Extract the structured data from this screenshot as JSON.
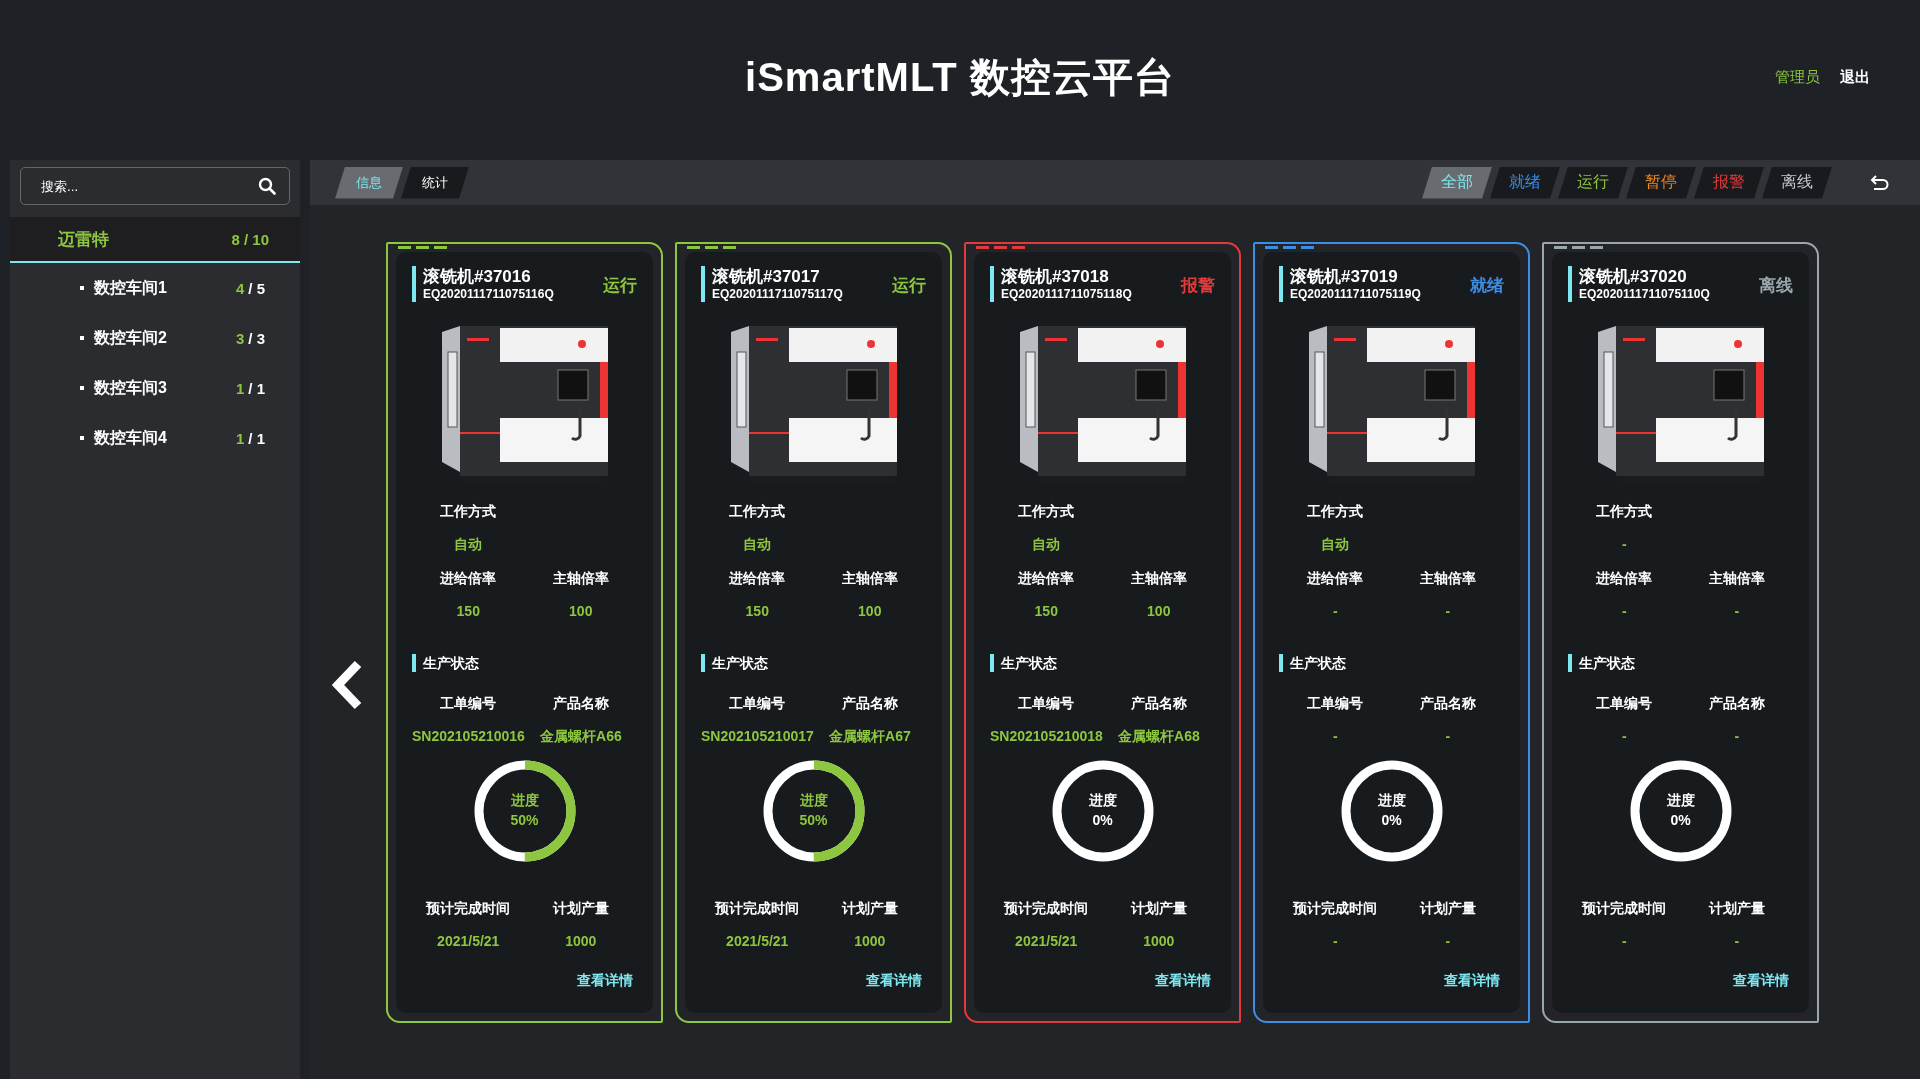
{
  "header": {
    "title": "iSmartMLT 数控云平台",
    "user": "管理员",
    "logout": "退出"
  },
  "sidebar": {
    "search": {
      "placeholder": "搜索..."
    },
    "tree": [
      {
        "name": "迈雷特",
        "count": "8 / 10",
        "selected": true,
        "children": [
          {
            "name": "数控车间1",
            "running": "4",
            "total": "/ 5",
            "selected": false
          },
          {
            "name": "数控车间2",
            "running": "3",
            "total": "/ 3",
            "selected": false
          },
          {
            "name": "数控车间3",
            "running": "1",
            "total": "/ 1",
            "selected": false
          },
          {
            "name": "数控车间4",
            "running": "1",
            "total": "/ 1",
            "selected": false
          }
        ]
      }
    ]
  },
  "view_tabs": [
    {
      "label": "信息",
      "selected": true
    },
    {
      "label": "统计",
      "selected": false
    }
  ],
  "filters": [
    {
      "label": "全部",
      "color": "#7ee8f0",
      "selected": true
    },
    {
      "label": "就绪",
      "color": "#3a8ee6",
      "selected": false
    },
    {
      "label": "运行",
      "color": "#8dc63f",
      "selected": false
    },
    {
      "label": "暂停",
      "color": "#f08a24",
      "selected": false
    },
    {
      "label": "报警",
      "color": "#e83a3a",
      "selected": false
    },
    {
      "label": "离线",
      "color": "#c0c6cc",
      "selected": false
    }
  ],
  "machines": [
    {
      "name": "滚铣机#37016",
      "serial": "EQ2020111711075116Q",
      "status": {
        "label": "运行",
        "kind": "running"
      },
      "work_mode_label": "工作方式",
      "work_mode": "自动",
      "feed_rate_label": "进给倍率",
      "feed_rate": "150",
      "spindle_rate_label": "主轴倍率",
      "spindle_rate": "100",
      "section_title": "生产状态",
      "order_label": "工单编号",
      "order": "SN202105210016",
      "product_label": "产品名称",
      "product": "金属螺杆A66",
      "progress": {
        "label": "进度",
        "value": "50%",
        "level": 0.5
      },
      "finish_label": "预计完成时间",
      "finish": "2021/5/21",
      "planned_label": "计划产量",
      "planned": "1000",
      "details": "查看详情"
    },
    {
      "name": "滚铣机#37017",
      "serial": "EQ2020111711075117Q",
      "status": {
        "label": "运行",
        "kind": "running"
      },
      "work_mode_label": "工作方式",
      "work_mode": "自动",
      "feed_rate_label": "进给倍率",
      "feed_rate": "150",
      "spindle_rate_label": "主轴倍率",
      "spindle_rate": "100",
      "section_title": "生产状态",
      "order_label": "工单编号",
      "order": "SN202105210017",
      "product_label": "产品名称",
      "product": "金属螺杆A67",
      "progress": {
        "label": "进度",
        "value": "50%",
        "level": 0.5
      },
      "finish_label": "预计完成时间",
      "finish": "2021/5/21",
      "planned_label": "计划产量",
      "planned": "1000",
      "details": "查看详情"
    },
    {
      "name": "滚铣机#37018",
      "serial": "EQ2020111711075118Q",
      "status": {
        "label": "报警",
        "kind": "alarm"
      },
      "work_mode_label": "工作方式",
      "work_mode": "自动",
      "feed_rate_label": "进给倍率",
      "feed_rate": "150",
      "spindle_rate_label": "主轴倍率",
      "spindle_rate": "100",
      "section_title": "生产状态",
      "order_label": "工单编号",
      "order": "SN202105210018",
      "product_label": "产品名称",
      "product": "金属螺杆A68",
      "progress": {
        "label": "进度",
        "value": "0%",
        "level": 0
      },
      "finish_label": "预计完成时间",
      "finish": "2021/5/21",
      "planned_label": "计划产量",
      "planned": "1000",
      "details": "查看详情"
    },
    {
      "name": "滚铣机#37019",
      "serial": "EQ2020111711075119Q",
      "status": {
        "label": "就绪",
        "kind": "ready"
      },
      "work_mode_label": "工作方式",
      "work_mode": "自动",
      "feed_rate_label": "进给倍率",
      "feed_rate": "-",
      "spindle_rate_label": "主轴倍率",
      "spindle_rate": "-",
      "section_title": "生产状态",
      "order_label": "工单编号",
      "order": "-",
      "product_label": "产品名称",
      "product": "-",
      "progress": {
        "label": "进度",
        "value": "0%",
        "level": 0
      },
      "finish_label": "预计完成时间",
      "finish": "-",
      "planned_label": "计划产量",
      "planned": "-",
      "details": "查看详情"
    },
    {
      "name": "滚铣机#37020",
      "serial": "EQ2020111711075110Q",
      "status": {
        "label": "离线",
        "kind": "offline"
      },
      "work_mode_label": "工作方式",
      "work_mode": "-",
      "feed_rate_label": "进给倍率",
      "feed_rate": "-",
      "spindle_rate_label": "主轴倍率",
      "spindle_rate": "-",
      "section_title": "生产状态",
      "order_label": "工单编号",
      "order": "-",
      "product_label": "产品名称",
      "product": "-",
      "progress": {
        "label": "进度",
        "value": "0%",
        "level": 0
      },
      "finish_label": "预计完成时间",
      "finish": "-",
      "planned_label": "计划产量",
      "planned": "-",
      "details": "查看详情"
    }
  ]
}
